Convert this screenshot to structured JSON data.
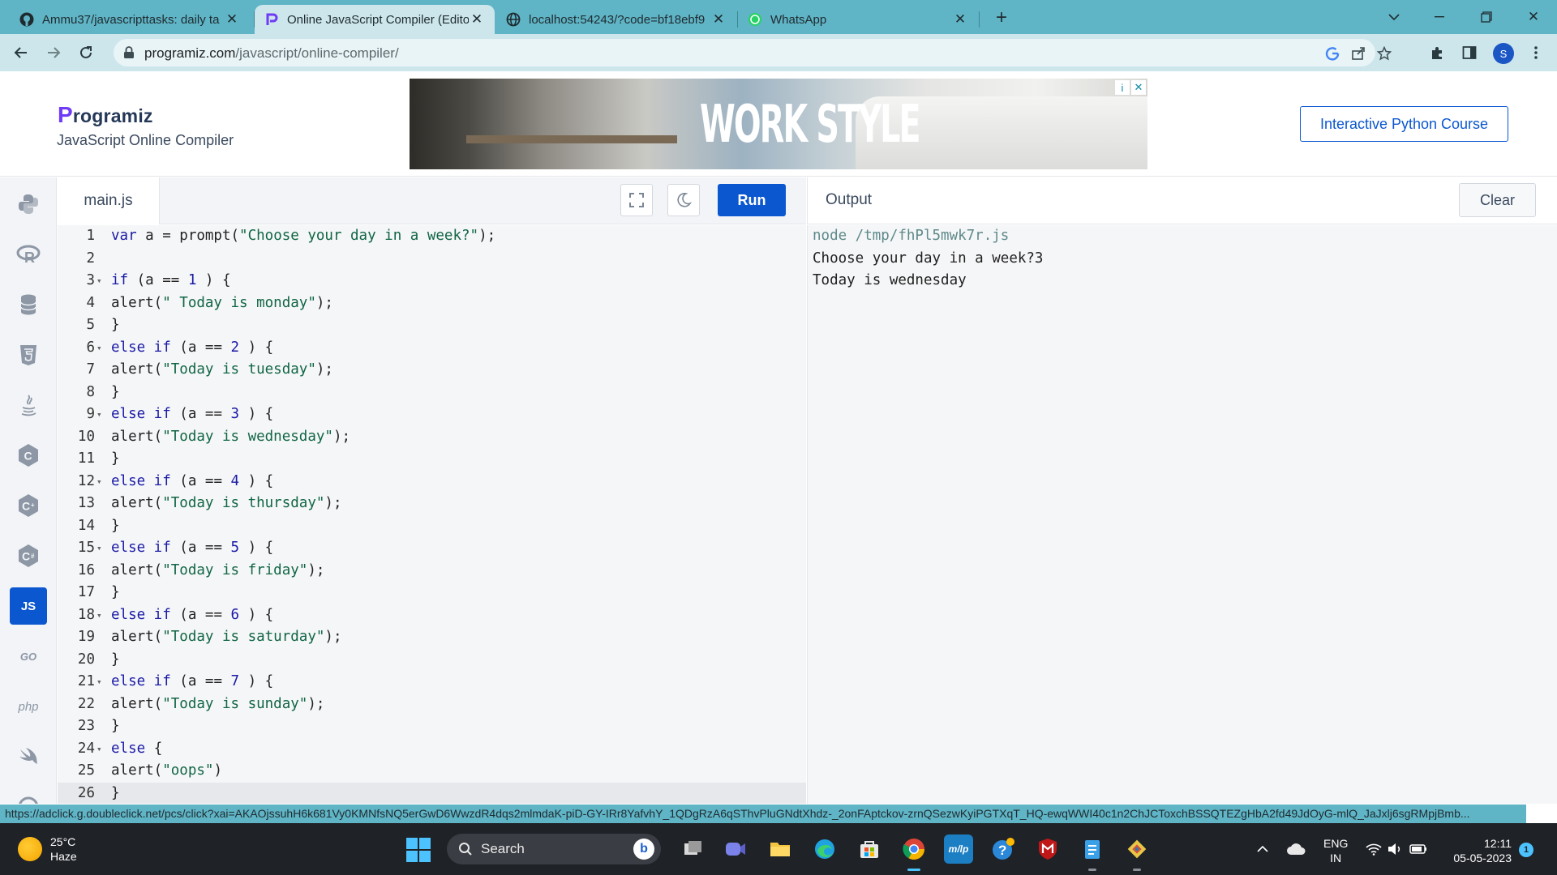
{
  "browser": {
    "tabs": [
      {
        "title": "Ammu37/javascripttasks: daily ta",
        "icon": "github-icon",
        "active": false
      },
      {
        "title": "Online JavaScript Compiler (Edito",
        "icon": "programiz-icon",
        "active": true
      },
      {
        "title": "localhost:54243/?code=bf18ebf9",
        "icon": "globe-icon",
        "active": false
      },
      {
        "title": "WhatsApp",
        "icon": "whatsapp-icon",
        "active": false
      }
    ],
    "url_host": "programiz.com",
    "url_path": "/javascript/online-compiler/",
    "profile_initial": "S",
    "status_url": "https://adclick.g.doubleclick.net/pcs/click?xai=AKAOjssuhH6k681Vy0KMNfsNQ5erGwD6WwzdR4dqs2mlmdaK-piD-GY-IRr8YafvhY_1QDgRzA6qSThvPluGNdtXhdz-_2onFAptckov-zrnQSezwKyiPGTXqT_HQ-ewqWWI40c1n2ChJCToxchBSSQTEZgHbA2fd49JdOyG-mlQ_JaJxlj6sgRMpjBmb..."
  },
  "site": {
    "logo_text": "rogramiz",
    "logo_p": "P",
    "subtitle": "JavaScript Online Compiler",
    "ad_text": "WORK STYLE",
    "ad_info": "i",
    "ad_close": "✕",
    "course_button": "Interactive Python Course"
  },
  "languages": [
    {
      "name": "python",
      "icon": "python-icon",
      "label": "",
      "active": false
    },
    {
      "name": "r",
      "icon": "r-icon",
      "label": "R",
      "active": false
    },
    {
      "name": "sql",
      "icon": "database-icon",
      "label": "",
      "active": false
    },
    {
      "name": "html",
      "icon": "html5-icon",
      "label": "",
      "active": false
    },
    {
      "name": "java",
      "icon": "java-icon",
      "label": "",
      "active": false
    },
    {
      "name": "c",
      "icon": "c-icon",
      "label": "C",
      "active": false
    },
    {
      "name": "cpp",
      "icon": "cplusplus-icon",
      "label": "C",
      "active": false
    },
    {
      "name": "csharp",
      "icon": "csharp-icon",
      "label": "C",
      "active": false
    },
    {
      "name": "javascript",
      "icon": "js-icon",
      "label": "JS",
      "active": true
    },
    {
      "name": "go",
      "icon": "go-icon",
      "label": "GO",
      "active": false
    },
    {
      "name": "php",
      "icon": "php-icon",
      "label": "php",
      "active": false
    },
    {
      "name": "swift",
      "icon": "swift-icon",
      "label": "",
      "active": false
    }
  ],
  "editor": {
    "filename": "main.js",
    "run_label": "Run",
    "current_line": 26,
    "lines": [
      {
        "n": "1",
        "fold": false,
        "code": [
          [
            "kw",
            "var"
          ],
          [
            "t",
            " a = prompt("
          ],
          [
            "str",
            "\"Choose your day in a week?\""
          ],
          [
            "t",
            ");"
          ]
        ]
      },
      {
        "n": "2",
        "fold": false,
        "code": []
      },
      {
        "n": "3",
        "fold": true,
        "code": [
          [
            "kw",
            "if"
          ],
          [
            "t",
            " (a == "
          ],
          [
            "num",
            "1"
          ],
          [
            "t",
            " ) {"
          ]
        ]
      },
      {
        "n": "4",
        "fold": false,
        "code": [
          [
            "t",
            "alert("
          ],
          [
            "str",
            "\" Today is monday\""
          ],
          [
            "t",
            ");"
          ]
        ]
      },
      {
        "n": "5",
        "fold": false,
        "code": [
          [
            "t",
            "}"
          ]
        ]
      },
      {
        "n": "6",
        "fold": true,
        "code": [
          [
            "kw",
            "else if"
          ],
          [
            "t",
            " (a == "
          ],
          [
            "num",
            "2"
          ],
          [
            "t",
            " ) {"
          ]
        ]
      },
      {
        "n": "7",
        "fold": false,
        "code": [
          [
            "t",
            "alert("
          ],
          [
            "str",
            "\"Today is tuesday\""
          ],
          [
            "t",
            ");"
          ]
        ]
      },
      {
        "n": "8",
        "fold": false,
        "code": [
          [
            "t",
            "}"
          ]
        ]
      },
      {
        "n": "9",
        "fold": true,
        "code": [
          [
            "kw",
            "else if"
          ],
          [
            "t",
            " (a == "
          ],
          [
            "num",
            "3"
          ],
          [
            "t",
            " ) {"
          ]
        ]
      },
      {
        "n": "10",
        "fold": false,
        "code": [
          [
            "t",
            "alert("
          ],
          [
            "str",
            "\"Today is wednesday\""
          ],
          [
            "t",
            ");"
          ]
        ]
      },
      {
        "n": "11",
        "fold": false,
        "code": [
          [
            "t",
            "}"
          ]
        ]
      },
      {
        "n": "12",
        "fold": true,
        "code": [
          [
            "kw",
            "else if"
          ],
          [
            "t",
            " (a == "
          ],
          [
            "num",
            "4"
          ],
          [
            "t",
            " ) {"
          ]
        ]
      },
      {
        "n": "13",
        "fold": false,
        "code": [
          [
            "t",
            "alert("
          ],
          [
            "str",
            "\"Today is thursday\""
          ],
          [
            "t",
            ");"
          ]
        ]
      },
      {
        "n": "14",
        "fold": false,
        "code": [
          [
            "t",
            "}"
          ]
        ]
      },
      {
        "n": "15",
        "fold": true,
        "code": [
          [
            "kw",
            "else if"
          ],
          [
            "t",
            " (a == "
          ],
          [
            "num",
            "5"
          ],
          [
            "t",
            " ) {"
          ]
        ]
      },
      {
        "n": "16",
        "fold": false,
        "code": [
          [
            "t",
            "alert("
          ],
          [
            "str",
            "\"Today is friday\""
          ],
          [
            "t",
            ");"
          ]
        ]
      },
      {
        "n": "17",
        "fold": false,
        "code": [
          [
            "t",
            "}"
          ]
        ]
      },
      {
        "n": "18",
        "fold": true,
        "code": [
          [
            "kw",
            "else if"
          ],
          [
            "t",
            " (a == "
          ],
          [
            "num",
            "6"
          ],
          [
            "t",
            " ) {"
          ]
        ]
      },
      {
        "n": "19",
        "fold": false,
        "code": [
          [
            "t",
            "alert("
          ],
          [
            "str",
            "\"Today is saturday\""
          ],
          [
            "t",
            ");"
          ]
        ]
      },
      {
        "n": "20",
        "fold": false,
        "code": [
          [
            "t",
            "}"
          ]
        ]
      },
      {
        "n": "21",
        "fold": true,
        "code": [
          [
            "kw",
            "else if"
          ],
          [
            "t",
            " (a == "
          ],
          [
            "num",
            "7"
          ],
          [
            "t",
            " ) {"
          ]
        ]
      },
      {
        "n": "22",
        "fold": false,
        "code": [
          [
            "t",
            "alert("
          ],
          [
            "str",
            "\"Today is sunday\""
          ],
          [
            "t",
            ");"
          ]
        ]
      },
      {
        "n": "23",
        "fold": false,
        "code": [
          [
            "t",
            "}"
          ]
        ]
      },
      {
        "n": "24",
        "fold": true,
        "code": [
          [
            "kw",
            "else"
          ],
          [
            "t",
            " {"
          ]
        ]
      },
      {
        "n": "25",
        "fold": false,
        "code": [
          [
            "t",
            "alert("
          ],
          [
            "str",
            "\"oops\""
          ],
          [
            "t",
            ")"
          ]
        ]
      },
      {
        "n": "26",
        "fold": false,
        "code": [
          [
            "t",
            "}"
          ]
        ]
      }
    ]
  },
  "output": {
    "title": "Output",
    "clear_label": "Clear",
    "lines": [
      {
        "text": "node /tmp/fhPl5mwk7r.js",
        "kind": "cmd"
      },
      {
        "text": "Choose your day in a week?3",
        "kind": "out"
      },
      {
        "text": "Today is wednesday",
        "kind": "out"
      }
    ]
  },
  "taskbar": {
    "temperature": "25°C",
    "weather": "Haze",
    "search_placeholder": "Search",
    "language": "ENG",
    "region": "IN",
    "time": "12:11",
    "date": "05-05-2023",
    "notification_count": "1",
    "colors": {
      "accent": "#4cc2ff",
      "taskbar_bg": "#1f2227"
    }
  },
  "colors": {
    "brand": "#0b57d0",
    "tab_strip": "#5fb4c6",
    "toolbar": "#cce6ec",
    "logo_accent": "#6f3bf5"
  }
}
